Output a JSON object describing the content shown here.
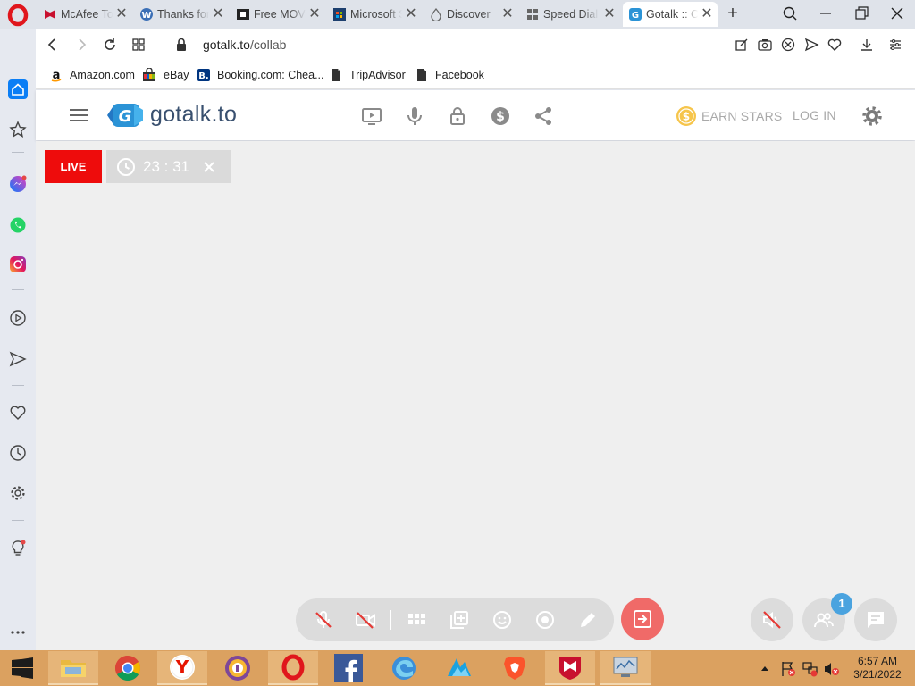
{
  "browser": {
    "tabs": [
      {
        "title": "McAfee Total Protection",
        "icon": "mcafee-icon",
        "active": false
      },
      {
        "title": "Thanks for downloading",
        "icon": "w-icon",
        "active": false
      },
      {
        "title": "Free MOVIES",
        "icon": "film-icon",
        "active": false
      },
      {
        "title": "Microsoft Store",
        "icon": "store-icon",
        "active": false
      },
      {
        "title": "Discover",
        "icon": "drop-icon",
        "active": false
      },
      {
        "title": "Speed Dial",
        "icon": "grid-icon",
        "active": false
      },
      {
        "title": "Gotalk :: Collab",
        "icon": "gotalk-icon",
        "active": true
      }
    ],
    "url_host": "gotalk.to",
    "url_path": "/collab",
    "bookmarks": [
      {
        "label": "Amazon.com",
        "icon": "amazon-icon"
      },
      {
        "label": "eBay",
        "icon": "ebay-icon"
      },
      {
        "label": "Booking.com: Chea...",
        "icon": "booking-icon"
      },
      {
        "label": "TripAdvisor",
        "icon": "page-icon"
      },
      {
        "label": "Facebook",
        "icon": "page-icon"
      }
    ]
  },
  "site": {
    "logo_text": "gotalk.to",
    "earn_stars_label": "EARN STARS",
    "login_label": "LOG IN"
  },
  "session": {
    "live_label": "LIVE",
    "timer_text": "23 : 31",
    "participant_count": "1"
  },
  "taskbar": {
    "time": "6:57 AM",
    "date": "3/21/2022"
  },
  "colors": {
    "live_red": "#ee0c0c",
    "exit_button": "#f06a68",
    "badge_blue": "#4aa3df",
    "logo_blue": "#2b93d6",
    "taskbar": "#dba160"
  }
}
